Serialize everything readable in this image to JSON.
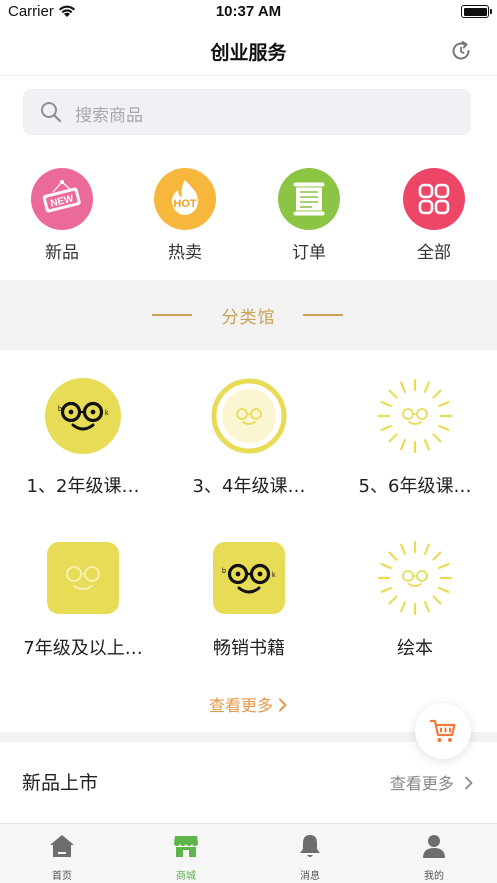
{
  "status_bar": {
    "carrier": "Carrier",
    "time": "10:37 AM"
  },
  "nav": {
    "title": "创业服务",
    "refresh_icon": "refresh-icon"
  },
  "search": {
    "placeholder": "搜索商品",
    "icon": "search-icon"
  },
  "quick_actions": [
    {
      "label": "新品",
      "badge": "NEW",
      "color": "#ec6a9a",
      "icon": "new-badge-icon"
    },
    {
      "label": "热卖",
      "badge": "HOT",
      "color": "#f6b73c",
      "icon": "hot-flame-icon"
    },
    {
      "label": "订单",
      "color": "#8cc444",
      "icon": "order-scroll-icon"
    },
    {
      "label": "全部",
      "color": "#ee4667",
      "icon": "grid-icon"
    }
  ],
  "category_section": {
    "title": "分类馆",
    "accent": "#c9a257"
  },
  "categories": [
    {
      "label": "1、2年级课…",
      "shape": "circle-solid"
    },
    {
      "label": "3、4年级课…",
      "shape": "circle-ring"
    },
    {
      "label": "5、6年级课…",
      "shape": "sunburst"
    },
    {
      "label": "7年级及以上…",
      "shape": "square-faded"
    },
    {
      "label": "畅销书籍",
      "shape": "square-solid"
    },
    {
      "label": "绘本",
      "shape": "sunburst"
    }
  ],
  "see_more_center": "查看更多",
  "new_arrivals": {
    "title": "新品上市",
    "more": "查看更多"
  },
  "tabs": [
    {
      "label": "首页",
      "icon": "home-icon",
      "active": false
    },
    {
      "label": "商城",
      "icon": "store-icon",
      "active": true
    },
    {
      "label": "消息",
      "icon": "bell-icon",
      "active": false
    },
    {
      "label": "我的",
      "icon": "profile-icon",
      "active": false
    }
  ],
  "colors": {
    "accent_orange": "#e39a4a",
    "mascot_yellow": "#e8dc57",
    "active_tab": "#5bb54a"
  }
}
